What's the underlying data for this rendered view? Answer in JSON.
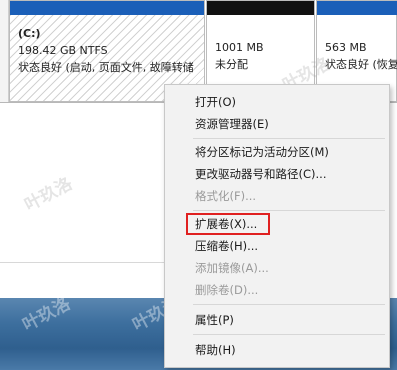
{
  "partitions": {
    "c": {
      "name": "(C:)",
      "size": "198.42 GB NTFS",
      "status": "状态良好 (启动, 页面文件, 故障转储"
    },
    "unallocated": {
      "size": "1001 MB",
      "status": "未分配"
    },
    "recovery": {
      "size": "563 MB",
      "status": "状态良好 (恢复"
    }
  },
  "context_menu": {
    "items": [
      {
        "label": "打开(O)",
        "enabled": true
      },
      {
        "label": "资源管理器(E)",
        "enabled": true
      },
      {
        "label": "将分区标记为活动分区(M)",
        "enabled": true
      },
      {
        "label": "更改驱动器号和路径(C)...",
        "enabled": true
      },
      {
        "label": "格式化(F)...",
        "enabled": false
      },
      {
        "label": "扩展卷(X)...",
        "enabled": true,
        "highlighted": true
      },
      {
        "label": "压缩卷(H)...",
        "enabled": true
      },
      {
        "label": "添加镜像(A)...",
        "enabled": false
      },
      {
        "label": "删除卷(D)...",
        "enabled": false
      },
      {
        "label": "属性(P)",
        "enabled": true
      },
      {
        "label": "帮助(H)",
        "enabled": true
      }
    ]
  },
  "watermark": "叶玖洛",
  "colors": {
    "partition_bar_primary": "#1b5fb8",
    "partition_bar_unallocated": "#111111",
    "highlight_border": "#e02020",
    "menu_background": "#f2f2f2",
    "disabled_text": "#9a9a9a"
  }
}
